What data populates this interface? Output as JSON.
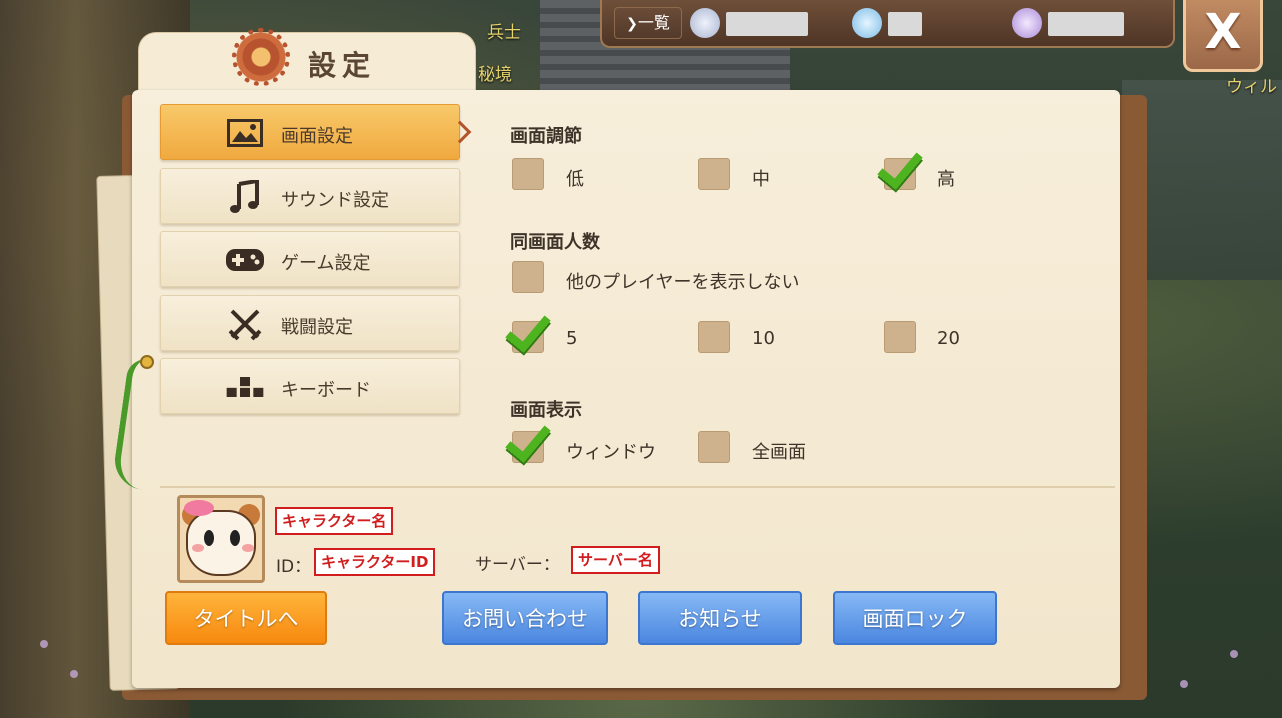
{
  "world": {
    "npc_labels": [
      "兵士",
      "秘境",
      "ウィル"
    ]
  },
  "topbar": {
    "list_label": "一覧",
    "currencies": [
      {
        "icon": "shell-icon",
        "color": "#c9d3e8"
      },
      {
        "icon": "blue-crystal-icon",
        "color": "#9fd3f2"
      },
      {
        "icon": "purple-crystal-icon",
        "color": "#c7a7e8"
      }
    ],
    "close_label": "X"
  },
  "panel": {
    "title": "設定"
  },
  "menu": {
    "items": [
      {
        "label": "画面設定",
        "icon": "image-icon",
        "active": true
      },
      {
        "label": "サウンド設定",
        "icon": "music-note-icon",
        "active": false
      },
      {
        "label": "ゲーム設定",
        "icon": "gamepad-icon",
        "active": false
      },
      {
        "label": "戦闘設定",
        "icon": "crossed-swords-icon",
        "active": false
      },
      {
        "label": "キーボード",
        "icon": "keyboard-icon",
        "active": false
      }
    ]
  },
  "options": {
    "quality": {
      "title": "画面調節",
      "choices": [
        {
          "label": "低",
          "checked": false
        },
        {
          "label": "中",
          "checked": false
        },
        {
          "label": "高",
          "checked": true
        }
      ]
    },
    "players": {
      "title": "同画面人数",
      "hide_label": "他のプレイヤーを表示しない",
      "hide_checked": false,
      "choices": [
        {
          "label": "5",
          "checked": true
        },
        {
          "label": "10",
          "checked": false
        },
        {
          "label": "20",
          "checked": false
        }
      ]
    },
    "display": {
      "title": "画面表示",
      "choices": [
        {
          "label": "ウィンドウ",
          "checked": true
        },
        {
          "label": "全画面",
          "checked": false
        }
      ]
    }
  },
  "character": {
    "name": "キャラクター名",
    "id_label": "ID：",
    "id_value": "キャラクターID",
    "server_label": "サーバー：",
    "server_value": "サーバー名"
  },
  "buttons": {
    "title": "タイトルへ",
    "contact": "お問い合わせ",
    "notice": "お知らせ",
    "lock": "画面ロック"
  },
  "colors": {
    "accent_orange": "#f7890f",
    "button_blue": "#4b87e0",
    "check_green": "#4db31f",
    "redact_red": "#d11d1d"
  }
}
